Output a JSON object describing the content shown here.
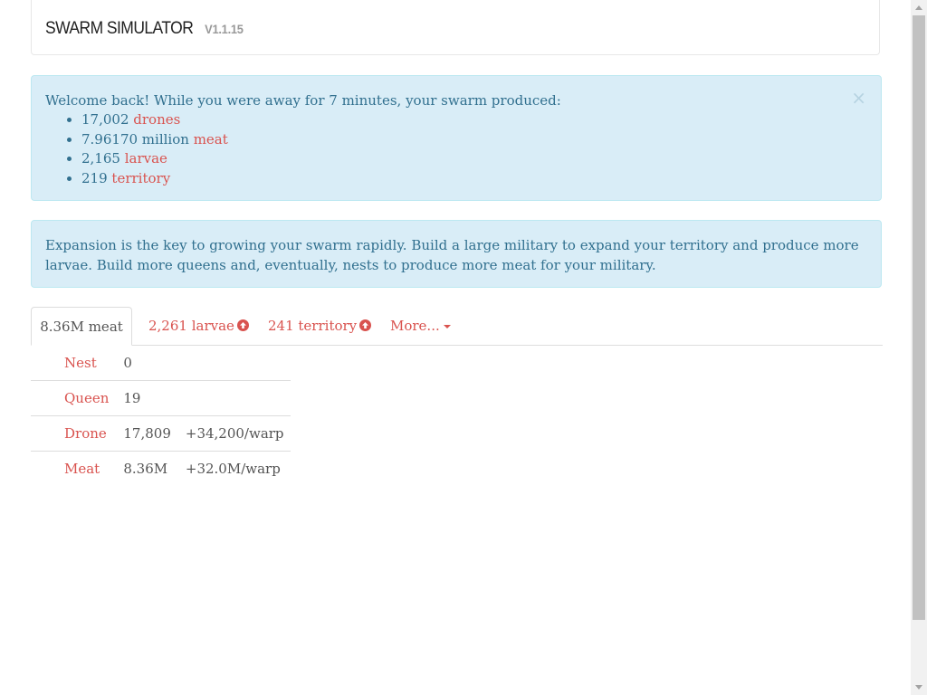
{
  "navbar": {
    "brand": "SWARM SIMULATOR",
    "version": "V1.1.15"
  },
  "welcome_alert": {
    "message": "Welcome back! While you were away for 7 minutes, your swarm produced:",
    "close_symbol": "×",
    "items": [
      {
        "amount": "17,002",
        "unit": "drones"
      },
      {
        "amount": "7.96170 million",
        "unit": "meat"
      },
      {
        "amount": "2,165",
        "unit": "larvae"
      },
      {
        "amount": "219",
        "unit": "territory"
      }
    ]
  },
  "tip_alert": {
    "text": "Expansion is the key to growing your swarm rapidly. Build a large military to expand your territory and produce more larvae. Build more queens and, eventually, nests to produce more meat for your military."
  },
  "tabs": {
    "meat": "8.36M meat",
    "larvae": "2,261 larvae",
    "territory": "241 territory",
    "more": "More..."
  },
  "units": [
    {
      "name": "Nest",
      "count": "0",
      "production": ""
    },
    {
      "name": "Queen",
      "count": "19",
      "production": ""
    },
    {
      "name": "Drone",
      "count": "17,809",
      "production": "+34,200/warp"
    },
    {
      "name": "Meat",
      "count": "8.36M",
      "production": "+32.0M/warp"
    }
  ],
  "colors": {
    "accent": "#d9534f",
    "info_bg": "#d9edf7",
    "info_text": "#31708f",
    "info_border": "#bce8f1"
  },
  "icons": {
    "upgrade": "arrow-up-circle-icon",
    "dropdown": "caret-down-icon",
    "close": "close-icon"
  }
}
